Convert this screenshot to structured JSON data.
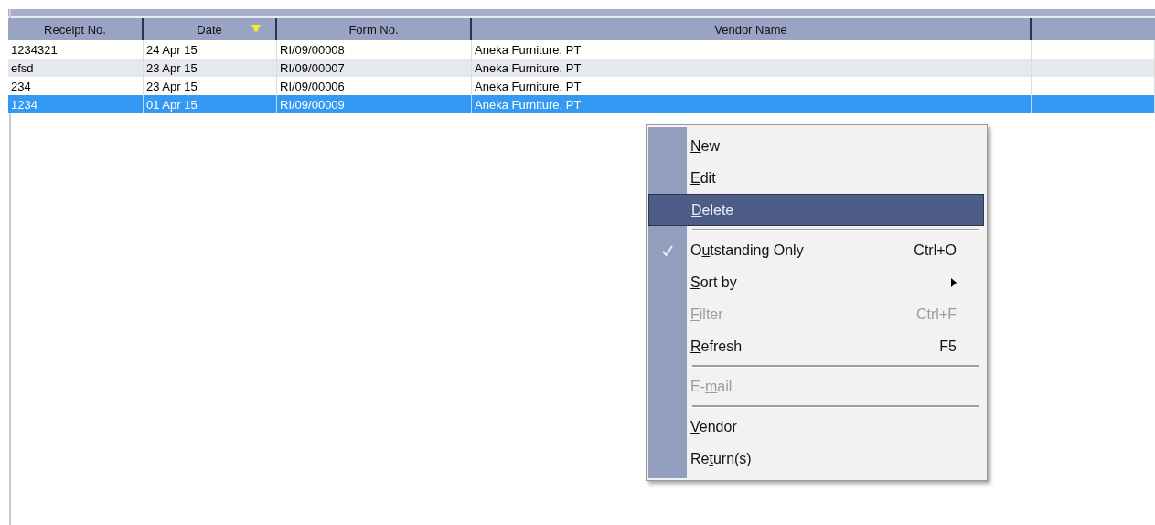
{
  "table": {
    "columns": [
      {
        "label": "Receipt No.",
        "sorted": false
      },
      {
        "label": "Date",
        "sorted": true
      },
      {
        "label": "Form No.",
        "sorted": false
      },
      {
        "label": "Vendor Name",
        "sorted": false
      }
    ],
    "rows": [
      {
        "cells": [
          "1234321",
          "24 Apr 15",
          "RI/09/00008",
          "Aneka Furniture, PT"
        ],
        "selected": false
      },
      {
        "cells": [
          "efsd",
          "23 Apr 15",
          "RI/09/00007",
          "Aneka Furniture, PT"
        ],
        "selected": false
      },
      {
        "cells": [
          "234",
          "23 Apr 15",
          "RI/09/00006",
          "Aneka Furniture, PT"
        ],
        "selected": false
      },
      {
        "cells": [
          "1234",
          "01 Apr 15",
          "RI/09/00009",
          "Aneka Furniture, PT"
        ],
        "selected": true
      }
    ]
  },
  "context_menu": {
    "items": [
      {
        "kind": "item",
        "access_key": "N",
        "label_after": "ew",
        "selected": false,
        "disabled": false,
        "checked": false,
        "submenu": false
      },
      {
        "kind": "item",
        "access_key": "E",
        "label_after": "dit",
        "selected": false,
        "disabled": false,
        "checked": false,
        "submenu": false
      },
      {
        "kind": "item",
        "access_key": "D",
        "label_after": "elete",
        "selected": true,
        "disabled": false,
        "checked": false,
        "submenu": false
      },
      {
        "kind": "separator"
      },
      {
        "kind": "item",
        "label_before": "O",
        "access_key": "u",
        "label_after": "tstanding Only",
        "shortcut": "Ctrl+O",
        "selected": false,
        "disabled": false,
        "checked": true,
        "submenu": false
      },
      {
        "kind": "item",
        "access_key": "S",
        "label_after": "ort by",
        "selected": false,
        "disabled": false,
        "checked": false,
        "submenu": true
      },
      {
        "kind": "item",
        "access_key": "F",
        "label_after": "ilter",
        "shortcut": "Ctrl+F",
        "selected": false,
        "disabled": true,
        "checked": false,
        "submenu": false
      },
      {
        "kind": "item",
        "access_key": "R",
        "label_after": "efresh",
        "shortcut": "F5",
        "selected": false,
        "disabled": false,
        "checked": false,
        "submenu": false
      },
      {
        "kind": "separator"
      },
      {
        "kind": "item",
        "label_before": "E-",
        "access_key": "m",
        "label_after": "ail",
        "selected": false,
        "disabled": true,
        "checked": false,
        "submenu": false
      },
      {
        "kind": "separator"
      },
      {
        "kind": "item",
        "access_key": "V",
        "label_after": "endor",
        "selected": false,
        "disabled": false,
        "checked": false,
        "submenu": false
      },
      {
        "kind": "item",
        "label_before": "Re",
        "access_key": "t",
        "label_after": "urn(s)",
        "selected": false,
        "disabled": false,
        "checked": false,
        "submenu": false
      }
    ]
  }
}
